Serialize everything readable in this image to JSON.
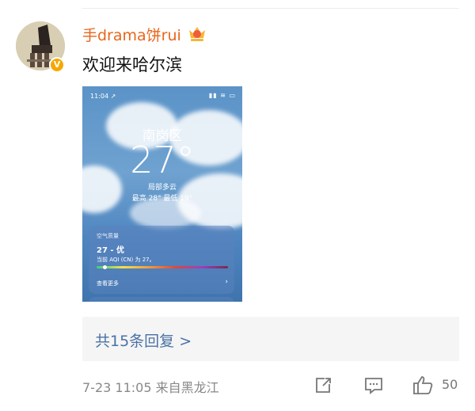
{
  "comment": {
    "username": "手drama饼rui",
    "text": "欢迎来哈尔滨",
    "badge_letter": "V",
    "replies_label": "共15条回复 >",
    "timestamp": "7-23 11:05",
    "location": "来自黑龙江",
    "like_count": "50"
  },
  "attached_image": {
    "time": "11:04 ↗",
    "status_icons": "▮▮ ≋ ▭",
    "city": "南岗区",
    "temperature": "27°",
    "condition": "局部多云",
    "hi_lo": "最高 28°   最低 19°",
    "aqi_title": "空气质量",
    "aqi_value": "27 - 优",
    "aqi_desc": "当前 AQI (CN) 为 27。",
    "see_more": "查看更多",
    "chevron": "›"
  },
  "colors": {
    "username": "#e8651a",
    "reply_link": "#4a72a6",
    "verified": "#f5a800"
  }
}
